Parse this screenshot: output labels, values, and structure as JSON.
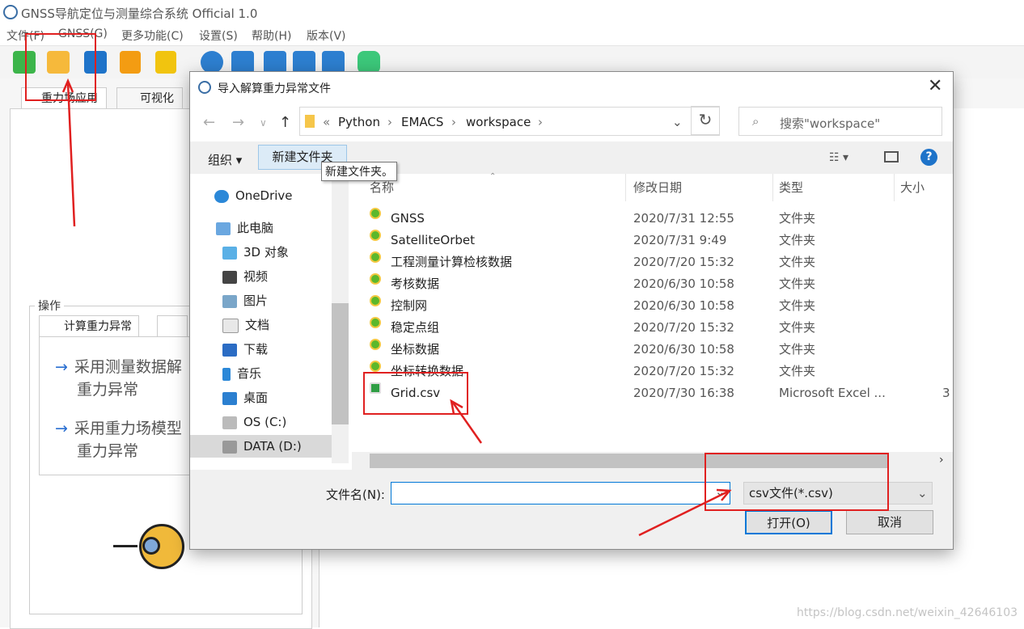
{
  "app": {
    "title": "GNSS导航定位与测量综合系统 Official 1.0",
    "menu": [
      "文件(F)",
      "GNSS(G)",
      "更多功能(C)",
      "设置(S)",
      "帮助(H)",
      "版本(V)"
    ],
    "tabs": [
      "重力场应用",
      "可视化"
    ],
    "group_label": "操作",
    "subtab": "计算重力异常",
    "options": [
      {
        "l1": "采用测量数据解",
        "l2": "重力异常"
      },
      {
        "l1": "采用重力场模型",
        "l2": "重力异常"
      }
    ]
  },
  "dialog": {
    "title": "导入解算重力异常文件",
    "close": "✕",
    "breadcrumb": [
      "Python",
      "EMACS",
      "workspace"
    ],
    "search_placeholder": "搜索\"workspace\"",
    "organize": "组织 ▾",
    "new_folder": "新建文件夹",
    "tooltip": "新建文件夹。",
    "help": "?",
    "nav": [
      "OneDrive",
      "此电脑",
      "3D 对象",
      "视频",
      "图片",
      "文档",
      "下载",
      "音乐",
      "桌面",
      "OS (C:)",
      "DATA (D:)"
    ],
    "columns": [
      "名称",
      "修改日期",
      "类型",
      "大小"
    ],
    "files": [
      {
        "name": "GNSS",
        "date": "2020/7/31 12:55",
        "type": "文件夹",
        "size": ""
      },
      {
        "name": "SatelliteOrbet",
        "date": "2020/7/31 9:49",
        "type": "文件夹",
        "size": ""
      },
      {
        "name": "工程测量计算检核数据",
        "date": "2020/7/20 15:32",
        "type": "文件夹",
        "size": ""
      },
      {
        "name": "考核数据",
        "date": "2020/6/30 10:58",
        "type": "文件夹",
        "size": ""
      },
      {
        "name": "控制网",
        "date": "2020/6/30 10:58",
        "type": "文件夹",
        "size": ""
      },
      {
        "name": "稳定点组",
        "date": "2020/7/20 15:32",
        "type": "文件夹",
        "size": ""
      },
      {
        "name": "坐标数据",
        "date": "2020/6/30 10:58",
        "type": "文件夹",
        "size": ""
      },
      {
        "name": "坐标转换数据",
        "date": "2020/7/20 15:32",
        "type": "文件夹",
        "size": ""
      },
      {
        "name": "Grid.csv",
        "date": "2020/7/30 16:38",
        "type": "Microsoft Excel ...",
        "size": "3"
      }
    ],
    "filename_label": "文件名(N):",
    "filename_value": "",
    "filetype": "csv文件(*.csv)",
    "open": "打开(O)",
    "cancel": "取消"
  },
  "watermark": "https://blog.csdn.net/weixin_42646103"
}
